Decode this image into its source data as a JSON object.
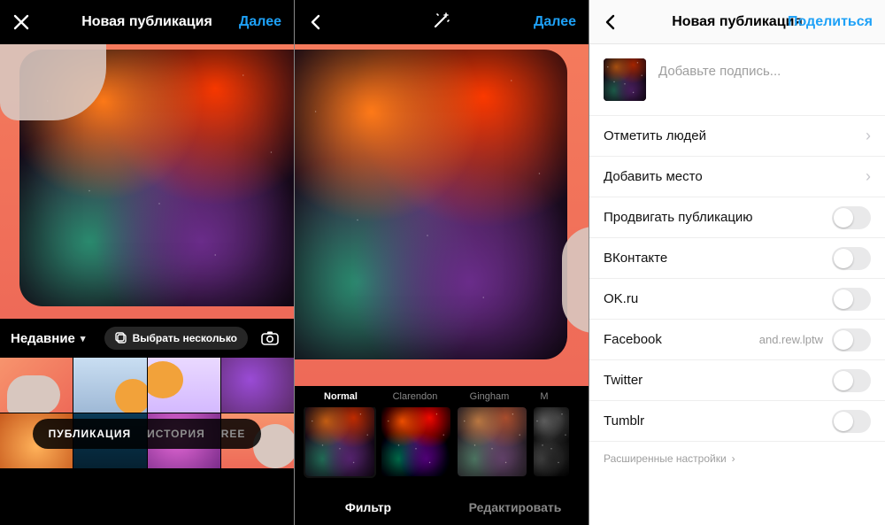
{
  "screen1": {
    "title": "Новая публикация",
    "action": "Далее",
    "albums_label": "Недавние",
    "multi_select": "Выбрать несколько",
    "modes": {
      "post": "ПУБЛИКАЦИЯ",
      "story": "ИСТОРИЯ",
      "reels": "REE"
    }
  },
  "screen2": {
    "action": "Далее",
    "filters": [
      {
        "name": "Normal",
        "active": true
      },
      {
        "name": "Clarendon",
        "active": false
      },
      {
        "name": "Gingham",
        "active": false
      },
      {
        "name": "M",
        "active": false
      }
    ],
    "tab_filter": "Фильтр",
    "tab_edit": "Редактировать"
  },
  "screen3": {
    "title": "Новая публикация",
    "action": "Поделиться",
    "caption_placeholder": "Добавьте подпись...",
    "rows": {
      "tag": "Отметить людей",
      "place": "Добавить место",
      "promote": "Продвигать публикацию",
      "vk": "ВКонтакте",
      "ok": "OK.ru",
      "fb": "Facebook",
      "fb_account": "and.rew.lptw",
      "tw": "Twitter",
      "tb": "Tumblr"
    },
    "advanced": "Расширенные настройки"
  }
}
